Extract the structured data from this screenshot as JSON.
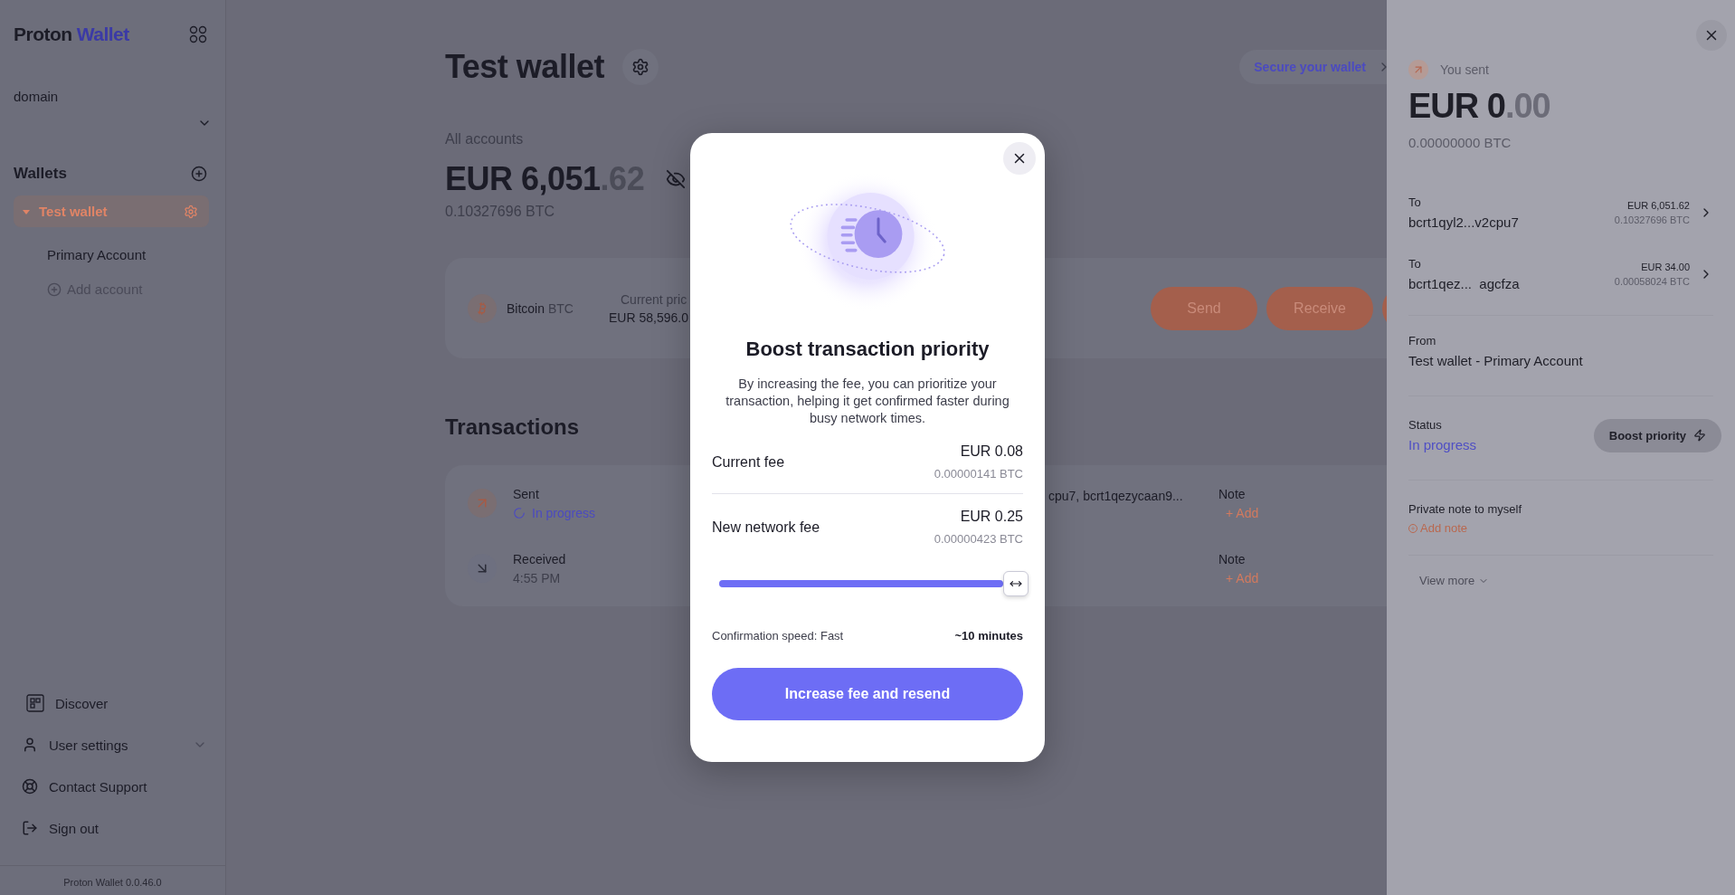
{
  "sidebar": {
    "logo": {
      "brand": "Proton",
      "product": "Wallet"
    },
    "account_selector": "domain",
    "wallets_heading": "Wallets",
    "wallets": [
      {
        "name": "Test wallet",
        "expanded": true,
        "selected": true,
        "children": [
          {
            "name": "Primary Account"
          }
        ]
      }
    ],
    "add_account": "Add account",
    "nav": [
      {
        "label": "Discover",
        "kind": "discover"
      },
      {
        "label": "User settings",
        "kind": "settings"
      },
      {
        "label": "Contact Support",
        "kind": "support"
      },
      {
        "label": "Sign out",
        "kind": "signout"
      }
    ],
    "version": "Proton Wallet 0.0.46.0"
  },
  "header": {
    "title": "Test wallet",
    "secure_link": "Secure your wallet"
  },
  "balance": {
    "label": "All accounts",
    "amount": "EUR 6,051",
    "amount_fraction": ".62",
    "btc": "0.10327696 BTC"
  },
  "asset": {
    "name": "Bitcoin",
    "ticker": "BTC",
    "price_label": "Current pric",
    "price": "EUR 58,596.0",
    "actions": [
      "Send",
      "Receive"
    ]
  },
  "transactions": {
    "heading": "Transactions",
    "rows": [
      {
        "kind": "sent",
        "type": "Sent",
        "status": "In progress",
        "pending": true,
        "address": "cpu7, bcrt1qezycaan9...",
        "note_label": "Note",
        "note_action": "+ Add"
      },
      {
        "kind": "received",
        "type": "Received",
        "status": "4:55 PM",
        "pending": false,
        "note_label": "Note",
        "note_action": "+ Add"
      }
    ]
  },
  "drawer": {
    "label": "You sent",
    "amount": "EUR 0",
    "amount_fraction": ".00",
    "btc": "0.00000000 BTC",
    "recipients": [
      {
        "label": "To",
        "address": "bcrt1qyl2...v2cpu7",
        "fiat": "EUR 6,051.62",
        "btc": "0.10327696 BTC"
      },
      {
        "label": "To",
        "address": "bcrt1qez...  agcfza",
        "fiat": "EUR 34.00",
        "btc": "0.00058024 BTC"
      }
    ],
    "from_label": "From",
    "from": "Test wallet - Primary Account",
    "status_label": "Status",
    "status": "In progress",
    "boost_button": "Boost priority",
    "note_label": "Private note to myself",
    "add_note": "Add note",
    "view_more": "View more"
  },
  "modal": {
    "title": "Boost transaction priority",
    "description": "By increasing the fee, you can prioritize your transaction, helping it get confirmed faster during busy network times.",
    "fees": [
      {
        "label": "Current fee",
        "fiat": "EUR 0.08",
        "btc": "0.00000141 BTC"
      },
      {
        "label": "New network fee",
        "fiat": "EUR 0.25",
        "btc": "0.00000423 BTC"
      }
    ],
    "slider": {
      "level": 1.0
    },
    "speed_label": "Confirmation speed: Fast",
    "speed_value": "~10 minutes",
    "submit": "Increase fee and resend"
  }
}
